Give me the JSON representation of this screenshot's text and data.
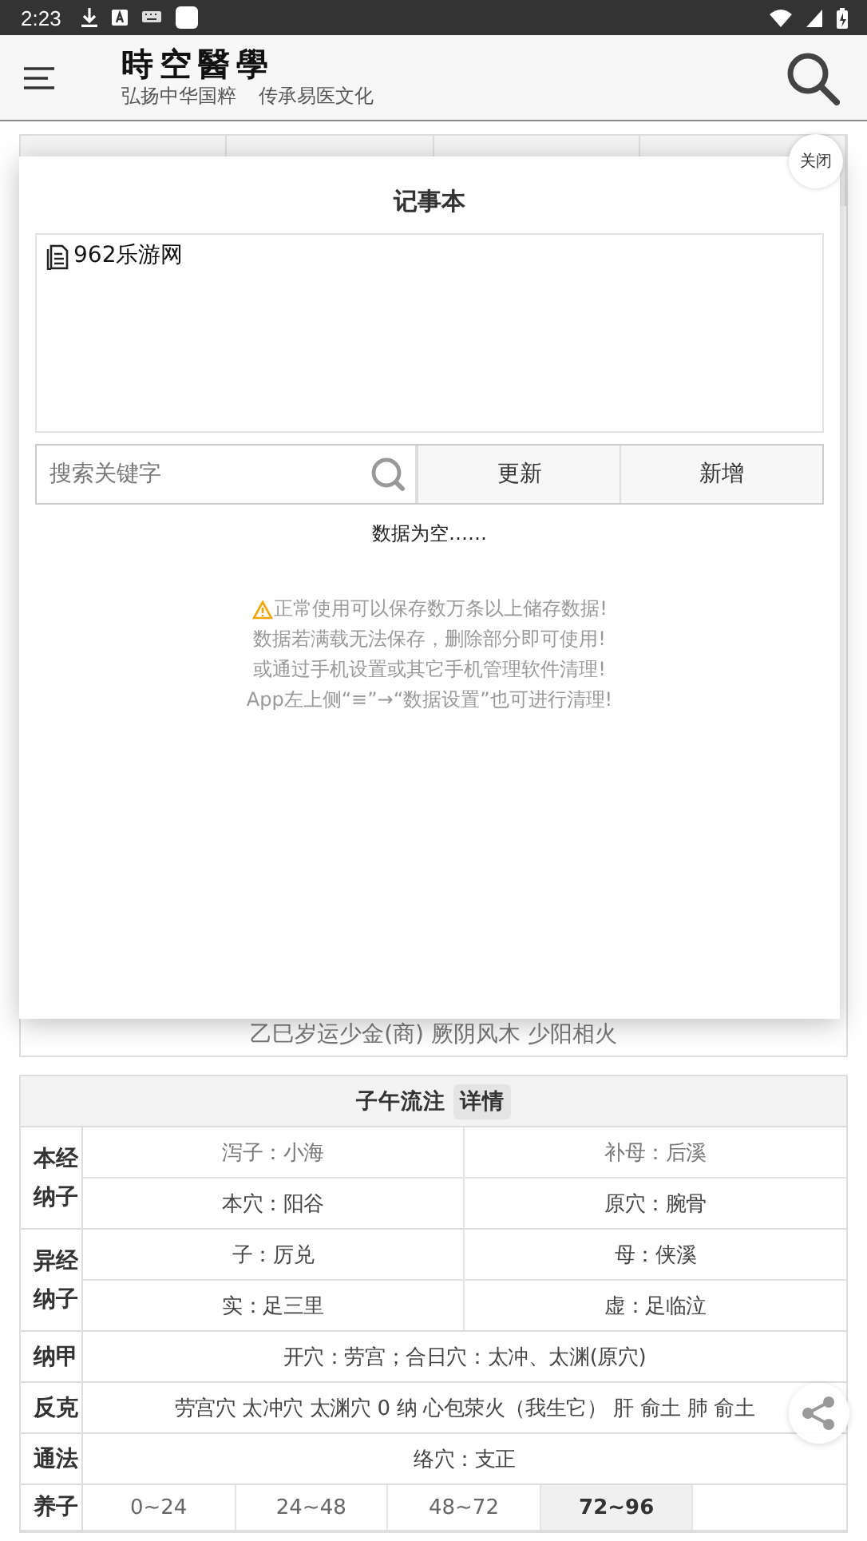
{
  "status_bar": {
    "time": "2:23"
  },
  "header": {
    "logo": "時空醫學",
    "slogans": [
      "弘扬中华国粹",
      "传承易医文化"
    ]
  },
  "background": {
    "line": "乙巳岁运少金(商)  厥阴风木  少阳相火"
  },
  "notebook": {
    "title": "记事本",
    "close": "关闭",
    "note_value": "962乐游网",
    "search": {
      "placeholder": "搜索关键字"
    },
    "buttons": [
      "更新",
      "新增"
    ],
    "empty": "数据为空……",
    "notes": [
      "正常使用可以保存数万条以上储存数据!",
      "数据若满载无法保存，删除部分即可使用!",
      "或通过手机设置或其它手机管理软件清理!",
      "App左上侧“≡”→“数据设置”也可进行清理!"
    ]
  },
  "table": {
    "title": "子午流注",
    "detail": "详情",
    "sections": [
      {
        "label": "本经纳子",
        "rows": [
          [
            {
              "text": "泻子：小海",
              "muted": true
            },
            {
              "text": "补母：后溪",
              "muted": true
            }
          ],
          [
            {
              "text": "本穴：阳谷",
              "muted": false
            },
            {
              "text": "原穴：腕骨",
              "muted": false
            }
          ]
        ]
      },
      {
        "label": "异经纳子",
        "rows": [
          [
            {
              "text": "子：厉兑",
              "muted": false
            },
            {
              "text": "母：侠溪",
              "muted": false
            }
          ],
          [
            {
              "text": "实：足三里",
              "muted": false
            },
            {
              "text": "虚：足临泣",
              "muted": false
            }
          ]
        ]
      },
      {
        "label": "纳甲",
        "rows": [
          [
            {
              "text": "开穴：劳宫；合日穴：太冲、太渊(原穴)",
              "muted": false
            }
          ]
        ]
      },
      {
        "label": "反克",
        "rows": [
          [
            {
              "text": "劳宫穴 太冲穴 太渊穴 0 纳 心包荥火（我生它） 肝 俞土 肺 俞土",
              "muted": false
            }
          ]
        ]
      },
      {
        "label": "通法",
        "rows": [
          [
            {
              "text": "络穴：支正",
              "muted": false
            }
          ]
        ]
      }
    ],
    "yangzi": {
      "label": "养子",
      "ranges": [
        {
          "text": "0~24",
          "selected": false
        },
        {
          "text": "24~48",
          "selected": false
        },
        {
          "text": "48~72",
          "selected": false
        },
        {
          "text": "72~96",
          "selected": true
        }
      ]
    }
  }
}
